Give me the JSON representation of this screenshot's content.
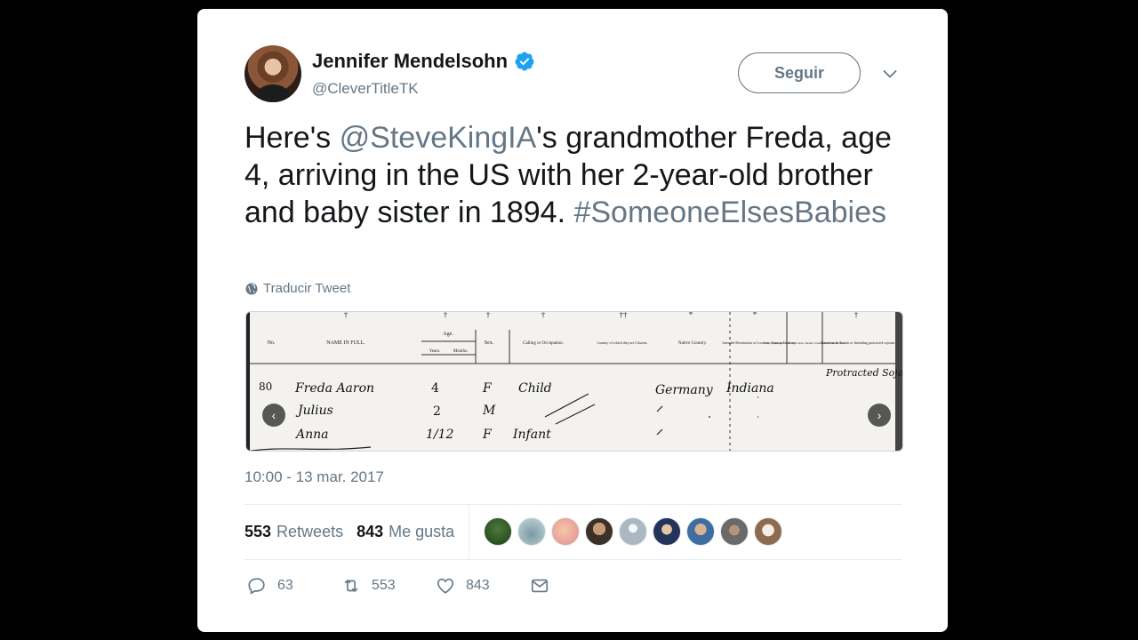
{
  "author": {
    "display_name": "Jennifer Mendelsohn",
    "handle": "@CleverTitleTK",
    "verified": true
  },
  "follow_label": "Seguir",
  "tweet": {
    "text_before_mention": "Here's ",
    "mention": "@SteveKingIA",
    "text_after_mention": "'s grandmother Freda, age 4, arriving in the US with her 2-year-old brother and baby sister in 1894. ",
    "hashtag": "#SomeoneElsesBabies"
  },
  "translate_label": "Traducir Tweet",
  "media": {
    "headers": [
      "No.",
      "NAME IN FULL.",
      "Age.",
      "Years.",
      "Months.",
      "Sex.",
      "Calling or Occupation.",
      "Country of which they are Citizens.",
      "Native Country.",
      "Intended Destination or Location, State or Territory.",
      "State of passengers other than Cabin, whether Citizens of the United States.",
      "Transient, In Transit or Intending protracted sojourn."
    ],
    "rows": [
      [
        "80",
        "Freda Aaron",
        "4",
        "F",
        "Child",
        "Germany",
        "Indiana",
        "Protracted Sojourn"
      ],
      [
        "",
        "Julius",
        "2",
        "M",
        "",
        "",
        "",
        ""
      ],
      [
        "",
        "Anna",
        "1/12",
        "F",
        "Infant",
        "",
        "",
        ""
      ]
    ]
  },
  "timestamp": "10:00 - 13 mar. 2017",
  "stats": {
    "retweets_count": "553",
    "retweets_label": "Retweets",
    "likes_count": "843",
    "likes_label": "Me gusta"
  },
  "actions": {
    "replies": "63",
    "retweets": "553",
    "likes": "843"
  },
  "colors": {
    "secondary_text": "#657786",
    "verified": "#1da1f2",
    "divider": "#e6ecf0"
  }
}
